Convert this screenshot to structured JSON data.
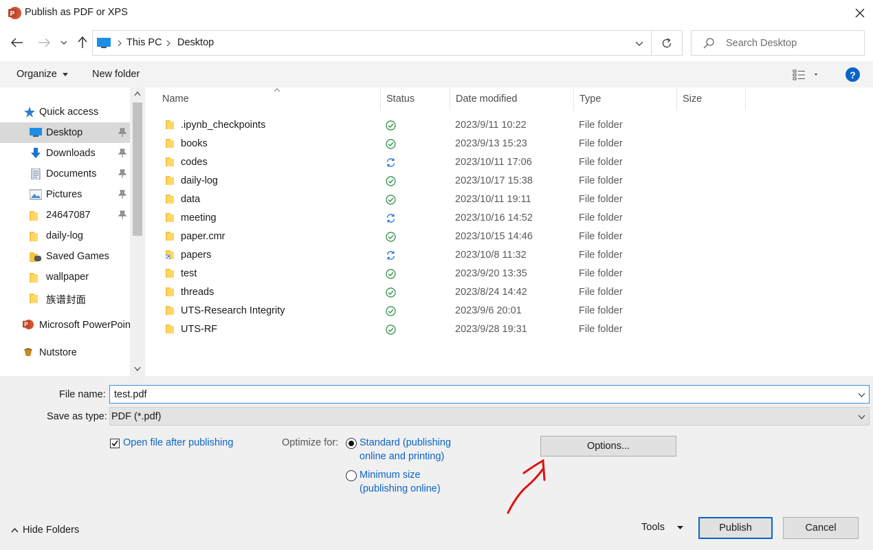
{
  "window": {
    "title": "Publish as PDF or XPS"
  },
  "address": {
    "crumbs": [
      "This PC",
      "Desktop"
    ]
  },
  "search": {
    "placeholder": "Search Desktop"
  },
  "toolbar": {
    "organize": "Organize",
    "new_folder": "New folder",
    "help": "?"
  },
  "nav": {
    "items": [
      {
        "label": "Quick access",
        "icon": "star-icon"
      },
      {
        "label": "Desktop",
        "icon": "desktop-icon",
        "selected": true,
        "pinned": true
      },
      {
        "label": "Downloads",
        "icon": "download-icon",
        "pinned": true
      },
      {
        "label": "Documents",
        "icon": "documents-icon",
        "pinned": true
      },
      {
        "label": "Pictures",
        "icon": "pictures-icon",
        "pinned": true
      },
      {
        "label": "24647087",
        "icon": "folder-icon",
        "pinned": true
      },
      {
        "label": "daily-log",
        "icon": "folder-icon"
      },
      {
        "label": "Saved Games",
        "icon": "saved-games-icon"
      },
      {
        "label": "wallpaper",
        "icon": "folder-icon"
      },
      {
        "label": "族谱封面",
        "icon": "folder-icon"
      },
      {
        "label": "Microsoft PowerPoin",
        "icon": "powerpoint-icon"
      },
      {
        "label": "Nutstore",
        "icon": "nutstore-icon"
      }
    ]
  },
  "files": {
    "columns": [
      "Name",
      "Status",
      "Date modified",
      "Type",
      "Size"
    ],
    "rows": [
      {
        "name": ".ipynb_checkpoints",
        "status": "synced",
        "date": "2023/9/11 10:22",
        "type": "File folder"
      },
      {
        "name": "books",
        "status": "synced",
        "date": "2023/9/13 15:23",
        "type": "File folder"
      },
      {
        "name": "codes",
        "status": "syncing",
        "date": "2023/10/11 17:06",
        "type": "File folder"
      },
      {
        "name": "daily-log",
        "status": "synced",
        "date": "2023/10/17 15:38",
        "type": "File folder"
      },
      {
        "name": "data",
        "status": "synced",
        "date": "2023/10/11 19:11",
        "type": "File folder"
      },
      {
        "name": "meeting",
        "status": "syncing",
        "date": "2023/10/16 14:52",
        "type": "File folder"
      },
      {
        "name": "paper.cmr",
        "status": "synced",
        "date": "2023/10/15 14:46",
        "type": "File folder"
      },
      {
        "name": "papers",
        "status": "syncing",
        "date": "2023/10/8 11:32",
        "type": "File folder"
      },
      {
        "name": "test",
        "status": "synced",
        "date": "2023/9/20 13:35",
        "type": "File folder"
      },
      {
        "name": "threads",
        "status": "synced",
        "date": "2023/8/24 14:42",
        "type": "File folder"
      },
      {
        "name": "UTS-Research Integrity",
        "status": "synced",
        "date": "2023/9/6 20:01",
        "type": "File folder"
      },
      {
        "name": "UTS-RF",
        "status": "synced",
        "date": "2023/9/28 19:31",
        "type": "File folder"
      }
    ]
  },
  "form": {
    "file_name_label": "File name:",
    "file_name_value": "test.pdf",
    "save_type_label": "Save as type:",
    "save_type_value": "PDF (*.pdf)",
    "open_after_label": "Open file after publishing",
    "open_after_checked": true,
    "optimize_label": "Optimize for:",
    "standard_line1": "Standard (publishing",
    "standard_line2": "online and printing)",
    "minimum_line1": "Minimum size",
    "minimum_line2": "(publishing online)",
    "options_label": "Options...",
    "hide_folders": "Hide Folders",
    "tools": "Tools",
    "publish": "Publish",
    "cancel": "Cancel"
  },
  "colors": {
    "accent": "#0a64c8",
    "sync_green": "#1e8a3a",
    "sync_blue": "#1a73d1",
    "annotation_red": "#e01010"
  }
}
